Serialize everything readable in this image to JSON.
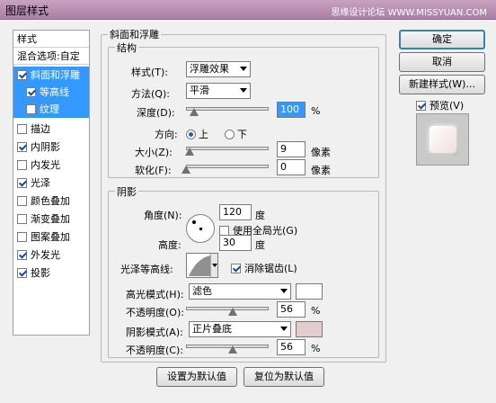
{
  "window": {
    "title": "图层样式",
    "watermark": "思缘设计论坛 WWW.MISSYUAN.COM"
  },
  "left_panel": {
    "header": "样式",
    "blend_options": "混合选项:自定",
    "items": [
      {
        "label": "斜面和浮雕",
        "checked": true
      },
      {
        "label": "等高线",
        "checked": true
      },
      {
        "label": "纹理",
        "checked": false
      },
      {
        "label": "描边",
        "checked": false
      },
      {
        "label": "内阴影",
        "checked": true
      },
      {
        "label": "内发光",
        "checked": false
      },
      {
        "label": "光泽",
        "checked": true
      },
      {
        "label": "颜色叠加",
        "checked": false
      },
      {
        "label": "渐变叠加",
        "checked": false
      },
      {
        "label": "图案叠加",
        "checked": false
      },
      {
        "label": "外发光",
        "checked": true
      },
      {
        "label": "投影",
        "checked": true
      }
    ]
  },
  "bevel": {
    "section_title": "斜面和浮雕",
    "structure_title": "结构",
    "style_label": "样式(T):",
    "style_value": "浮雕效果",
    "technique_label": "方法(Q):",
    "technique_value": "平滑",
    "depth_label": "深度(D):",
    "depth_value": "100",
    "depth_unit": "%",
    "depth_level": 0.1,
    "direction_label": "方向:",
    "direction_up": "上",
    "direction_down": "下",
    "size_label": "大小(Z):",
    "size_value": "9",
    "size_unit": "像素",
    "size_level": 0.04,
    "soften_label": "软化(F):",
    "soften_value": "0",
    "soften_unit": "像素",
    "soften_level": 0.0
  },
  "shading": {
    "title": "阴影",
    "angle_label": "角度(N):",
    "angle_value": "120",
    "angle_unit": "度",
    "global_light_label": "使用全局光(G)",
    "altitude_label": "高度:",
    "altitude_value": "30",
    "altitude_unit": "度",
    "gloss_contour_label": "光泽等高线:",
    "antialias_label": "消除锯齿(L)",
    "highlight_mode_label": "高光模式(H):",
    "highlight_mode_value": "滤色",
    "highlight_color": "#ffffff",
    "highlight_opacity_label": "不透明度(O):",
    "highlight_opacity_value": "56",
    "highlight_opacity_unit": "%",
    "highlight_opacity_level": 0.56,
    "shadow_mode_label": "阴影模式(A):",
    "shadow_mode_value": "正片叠底",
    "shadow_color": "#e3cccc",
    "shadow_opacity_label": "不透明度(C):",
    "shadow_opacity_value": "56",
    "shadow_opacity_unit": "%",
    "shadow_opacity_level": 0.56
  },
  "footer": {
    "set_default": "设置为默认值",
    "reset_default": "复位为默认值"
  },
  "buttons": {
    "ok": "确定",
    "cancel": "取消",
    "new_style": "新建样式(W)...",
    "preview_label": "预览(V)"
  }
}
